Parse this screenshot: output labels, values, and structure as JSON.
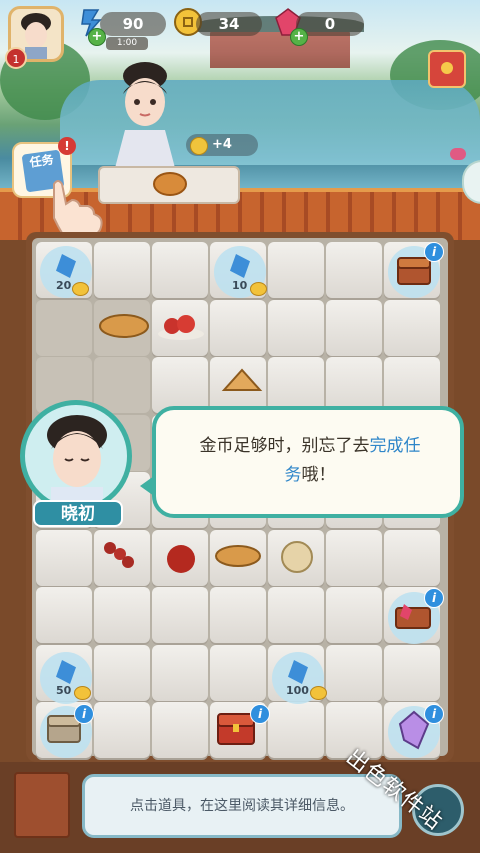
{
  "hud": {
    "player_level": "1",
    "stamina": "90",
    "stamina_timer": "1:00",
    "coins": "34",
    "gems": "0"
  },
  "customer": {
    "reward": "+4"
  },
  "quest_button": {
    "label": "任务",
    "alert": "!"
  },
  "board": {
    "chips": [
      "20",
      "10",
      "50",
      "100"
    ]
  },
  "dialog": {
    "speaker": "晓初",
    "text_plain": "金币足够时，别忘了去",
    "text_highlight_1": "完成任",
    "text_highlight_2": "务",
    "text_end": "哦！"
  },
  "bottom": {
    "hint": "点击道具，在这里阅读其详细信息。"
  },
  "watermark": "出色软件站",
  "colors": {
    "teal_accent": "#3fb0a2",
    "highlight_blue": "#2f86c9",
    "alert_red": "#d63a35"
  }
}
